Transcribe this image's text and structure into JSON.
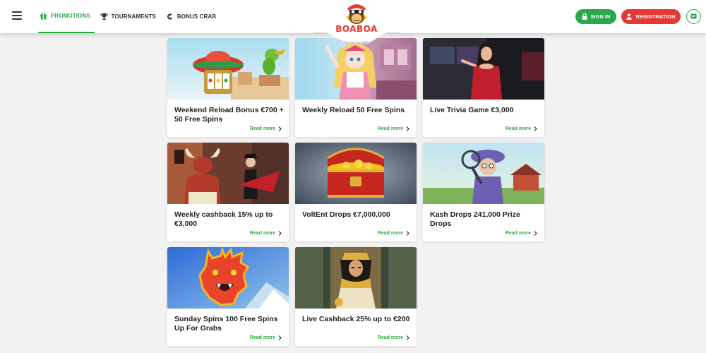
{
  "nav": {
    "items": [
      {
        "label": "PROMOTIONS",
        "icon": "gift-icon",
        "active": true
      },
      {
        "label": "TOURNAMENTS",
        "icon": "trophy-icon",
        "active": false
      },
      {
        "label": "BONUS CRAB",
        "icon": "crab-claw-icon",
        "active": false
      }
    ]
  },
  "logo": {
    "text": "BOABOA"
  },
  "auth": {
    "signin_label": "SIGN IN",
    "register_label": "REGISTRATION"
  },
  "colors": {
    "brand_green": "#27ae3f",
    "brand_red": "#e53935"
  },
  "promotions": [
    {
      "title": "Weekend Reload Bonus €700 + 50 Free Spins",
      "link": "Read more"
    },
    {
      "title": "Weekly Reload 50 Free Spins",
      "link": "Read more"
    },
    {
      "title": "Live Trivia Game €3,000",
      "link": "Read more"
    },
    {
      "title": "Weekly cashback 15% up to €3,000",
      "link": "Read more"
    },
    {
      "title": "VoltEnt Drops €7,000,000",
      "link": "Read more"
    },
    {
      "title": "Kash Drops 241,000 Prize Drops",
      "link": "Read more"
    },
    {
      "title": "Sunday Spins 100 Free Spins Up For Grabs",
      "link": "Read more"
    },
    {
      "title": "Live Cashback 25% up to €200",
      "link": "Read more"
    }
  ]
}
